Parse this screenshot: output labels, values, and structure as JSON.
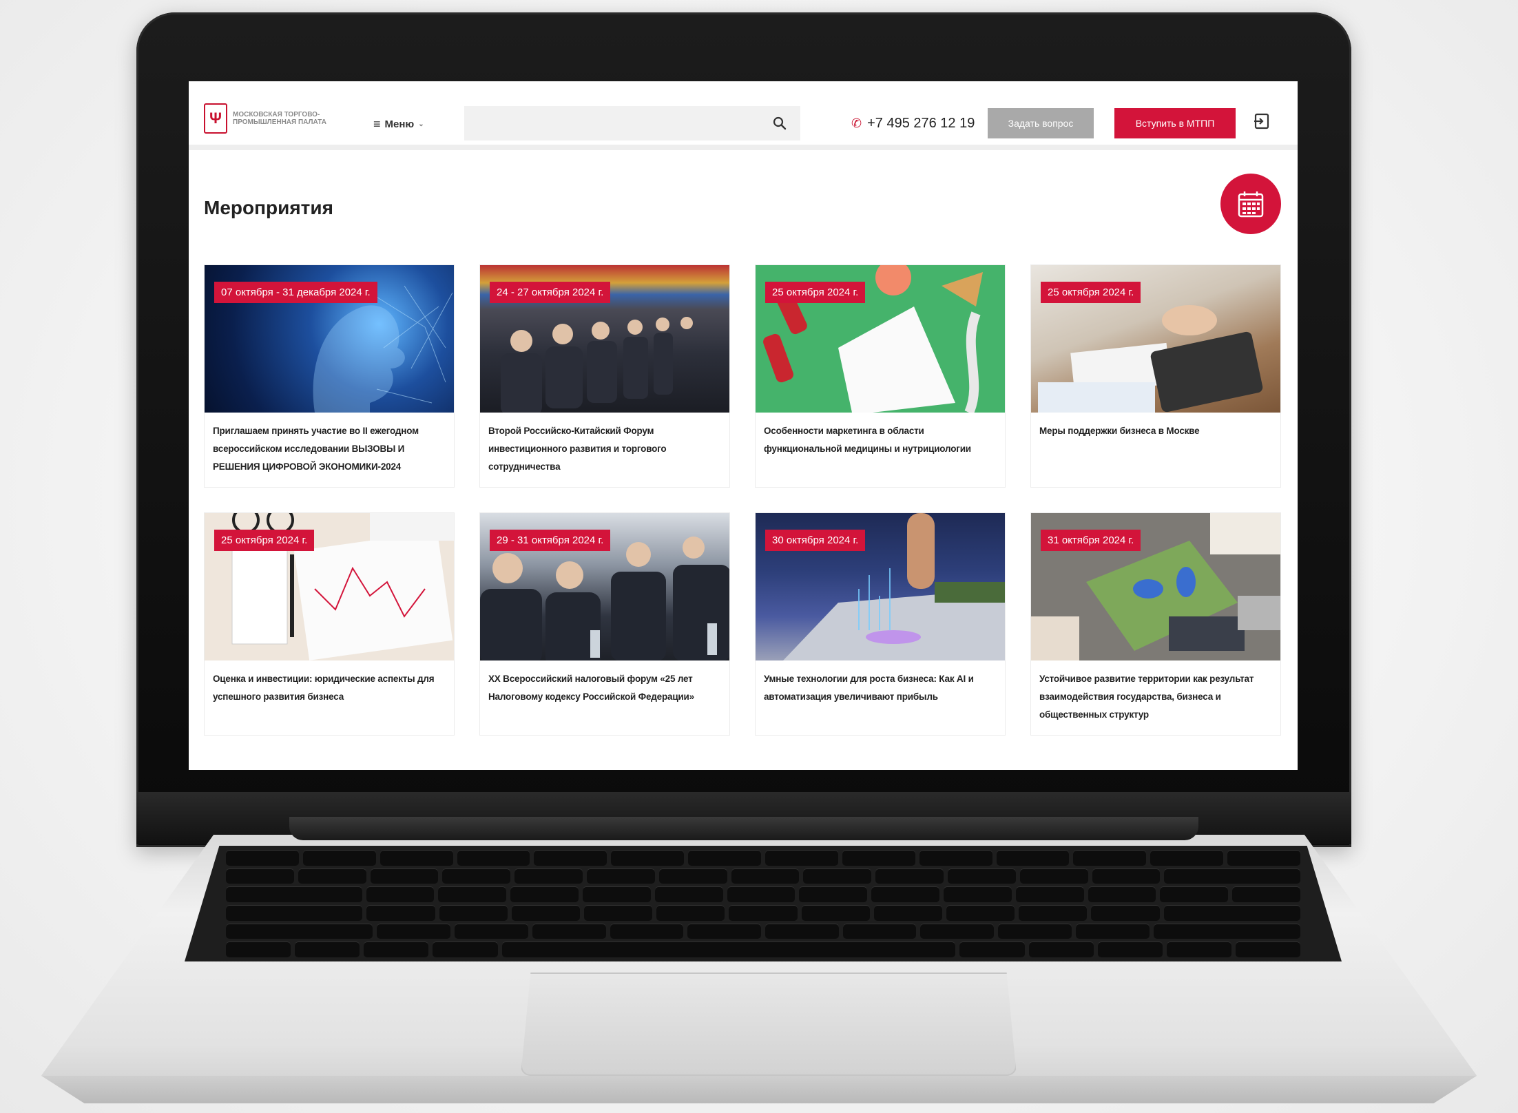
{
  "header": {
    "logo_text": "Московская торгово-промышленная палата",
    "menu_label": "Меню",
    "search_placeholder": "",
    "phone": "+7 495 276 12 19",
    "ask_button": "Задать вопрос",
    "join_button": "Вступить в МТПП"
  },
  "page": {
    "title": "Мероприятия"
  },
  "events": [
    {
      "date": "07 октября - 31 декабря 2024 г.",
      "title": "Приглашаем принять участие во II ежегодном всероссийском исследовании ВЫЗОВЫ И РЕШЕНИЯ ЦИФРОВОЙ ЭКОНОМИКИ-2024",
      "image": "ai-face-network"
    },
    {
      "date": "24 - 27 октября 2024 г.",
      "title": "Второй Российско-Китайский Форум инвестиционного развития и торгового сотрудничества",
      "image": "conference-audience"
    },
    {
      "date": "25 октября 2024 г.",
      "title": "Особенности маркетинга в области функциональной медицины и нутрициологии",
      "image": "clipboard-dumbbells"
    },
    {
      "date": "25 октября 2024 г.",
      "title": "Меры поддержки бизнеса в Москве",
      "image": "business-tablet-desk"
    },
    {
      "date": "25 октября 2024 г.",
      "title": "Оценка и инвестиции: юридические аспекты для успешного развития бизнеса",
      "image": "chart-notebook-keyboard"
    },
    {
      "date": "29 - 31 октября 2024 г.",
      "title": "XX Всероссийский налоговый форум «25 лет Налоговому кодексу Российской Федерации»",
      "image": "forum-panel"
    },
    {
      "date": "30 октября 2024 г.",
      "title": "Умные технологии для роста бизнеса: Как AI и автоматизация увеличивают прибыль",
      "image": "laptop-hologram"
    },
    {
      "date": "31 октября 2024 г.",
      "title": "Устойчивое развитие территории как результат взаимодействия государства, бизнеса и общественных структур",
      "image": "urban-planning-model"
    }
  ],
  "colors": {
    "accent": "#d3143a",
    "button_gray": "#a9a9a9"
  }
}
